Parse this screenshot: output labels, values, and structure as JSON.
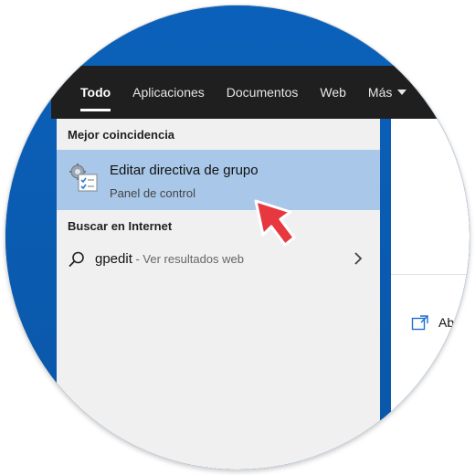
{
  "tabs": [
    {
      "label": "Todo"
    },
    {
      "label": "Aplicaciones"
    },
    {
      "label": "Documentos"
    },
    {
      "label": "Web"
    },
    {
      "label": "Más"
    }
  ],
  "best_match": {
    "heading": "Mejor coincidencia",
    "title": "Editar directiva de grupo",
    "subtitle": "Panel de control",
    "icon": "group-policy-editor-icon"
  },
  "web_search": {
    "heading": "Buscar en Internet",
    "query": "gpedit",
    "suffix": " - Ver resultados web"
  },
  "right_pane": {
    "open_label": "Abri"
  },
  "colors": {
    "tabbar": "#1f1f1f",
    "selection": "#a9c7e8",
    "pane": "#f0f0f0",
    "desktop": "#0b61ba",
    "pointer": "#e8383f"
  }
}
